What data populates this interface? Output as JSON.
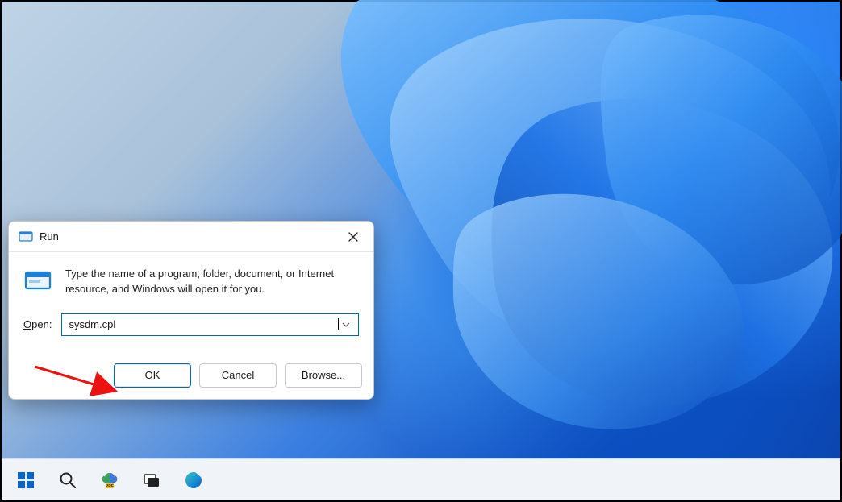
{
  "dialog": {
    "title": "Run",
    "description": "Type the name of a program, folder, document, or Internet resource, and Windows will open it for you.",
    "open_label_prefix": "O",
    "open_label_rest": "pen:",
    "input_value": "sysdm.cpl",
    "buttons": {
      "ok": "OK",
      "cancel": "Cancel",
      "browse_prefix": "B",
      "browse_rest": "rowse..."
    }
  },
  "taskbar": {
    "items": [
      "start",
      "search",
      "office-pre",
      "task-view",
      "edge"
    ]
  }
}
